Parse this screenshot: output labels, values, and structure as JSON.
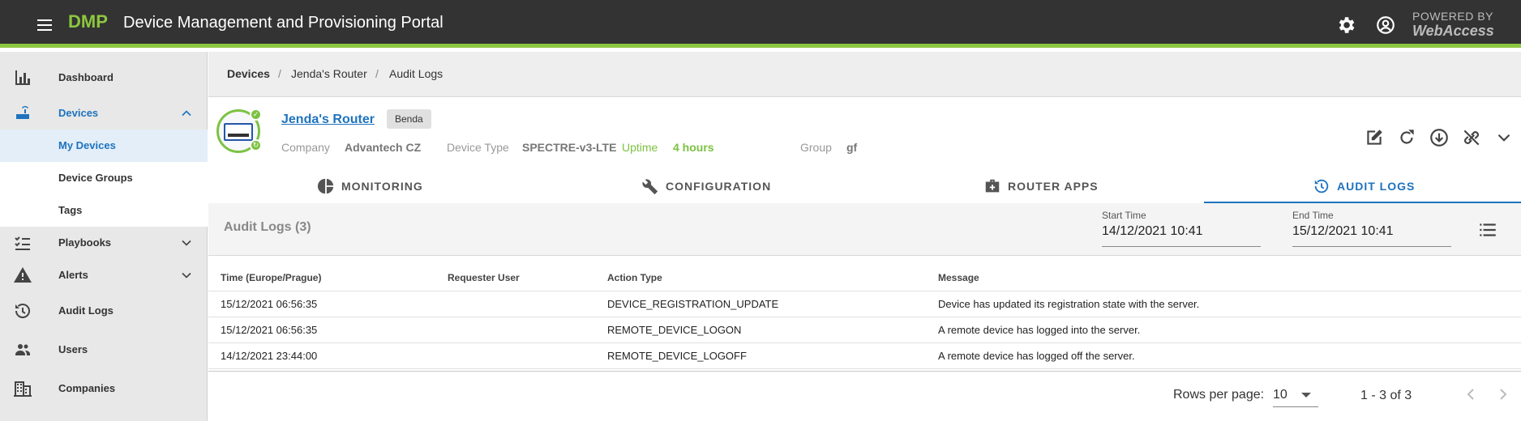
{
  "header": {
    "logo": "DMP",
    "title": "Device Management and Provisioning Portal",
    "powered_line1": "POWERED BY",
    "powered_line2": "WebAccess"
  },
  "sidebar": {
    "items": [
      {
        "label": "Dashboard",
        "icon": "bar-chart-icon"
      },
      {
        "label": "Devices",
        "icon": "router-icon",
        "active": true
      },
      {
        "label": "Playbooks",
        "icon": "checklist-icon"
      },
      {
        "label": "Alerts",
        "icon": "warning-icon"
      },
      {
        "label": "Audit Logs",
        "icon": "history-icon"
      },
      {
        "label": "Users",
        "icon": "users-icon"
      },
      {
        "label": "Companies",
        "icon": "building-icon"
      }
    ],
    "device_subitems": [
      {
        "label": "My Devices",
        "selected": true
      },
      {
        "label": "Device Groups"
      },
      {
        "label": "Tags"
      }
    ]
  },
  "breadcrumb": [
    "Devices",
    "Jenda's Router",
    "Audit Logs"
  ],
  "device": {
    "name": "Jenda's Router",
    "tag": "Benda",
    "company_label": "Company",
    "company": "Advantech CZ",
    "type_label": "Device Type",
    "type": "SPECTRE-v3-LTE",
    "uptime_label": "Uptime",
    "uptime": "4 hours",
    "group_label": "Group",
    "group": "gf"
  },
  "tabs": [
    {
      "label": "MONITORING",
      "icon": "pie-chart-icon"
    },
    {
      "label": "CONFIGURATION",
      "icon": "wrench-icon"
    },
    {
      "label": "ROUTER APPS",
      "icon": "briefcase-plus-icon"
    },
    {
      "label": "AUDIT LOGS",
      "icon": "history-icon",
      "active": true
    }
  ],
  "audit": {
    "title": "Audit Logs (3)",
    "start_label": "Start Time",
    "start_value": "14/12/2021 10:41",
    "end_label": "End Time",
    "end_value": "15/12/2021 10:41"
  },
  "table": {
    "columns": [
      "Time (Europe/Prague)",
      "Requester User",
      "Action Type",
      "Message"
    ],
    "rows": [
      [
        "15/12/2021 06:56:35",
        "",
        "DEVICE_REGISTRATION_UPDATE",
        "Device has updated its registration state with the server."
      ],
      [
        "15/12/2021 06:56:35",
        "",
        "REMOTE_DEVICE_LOGON",
        "A remote device has logged into the server."
      ],
      [
        "14/12/2021 23:44:00",
        "",
        "REMOTE_DEVICE_LOGOFF",
        "A remote device has logged off the server."
      ]
    ]
  },
  "pager": {
    "rows_label": "Rows per page:",
    "rows_value": "10",
    "range": "1 - 3 of 3"
  },
  "colors": {
    "accent_green": "#8dc63f",
    "link_blue": "#1e73be",
    "topbar": "#333333"
  }
}
